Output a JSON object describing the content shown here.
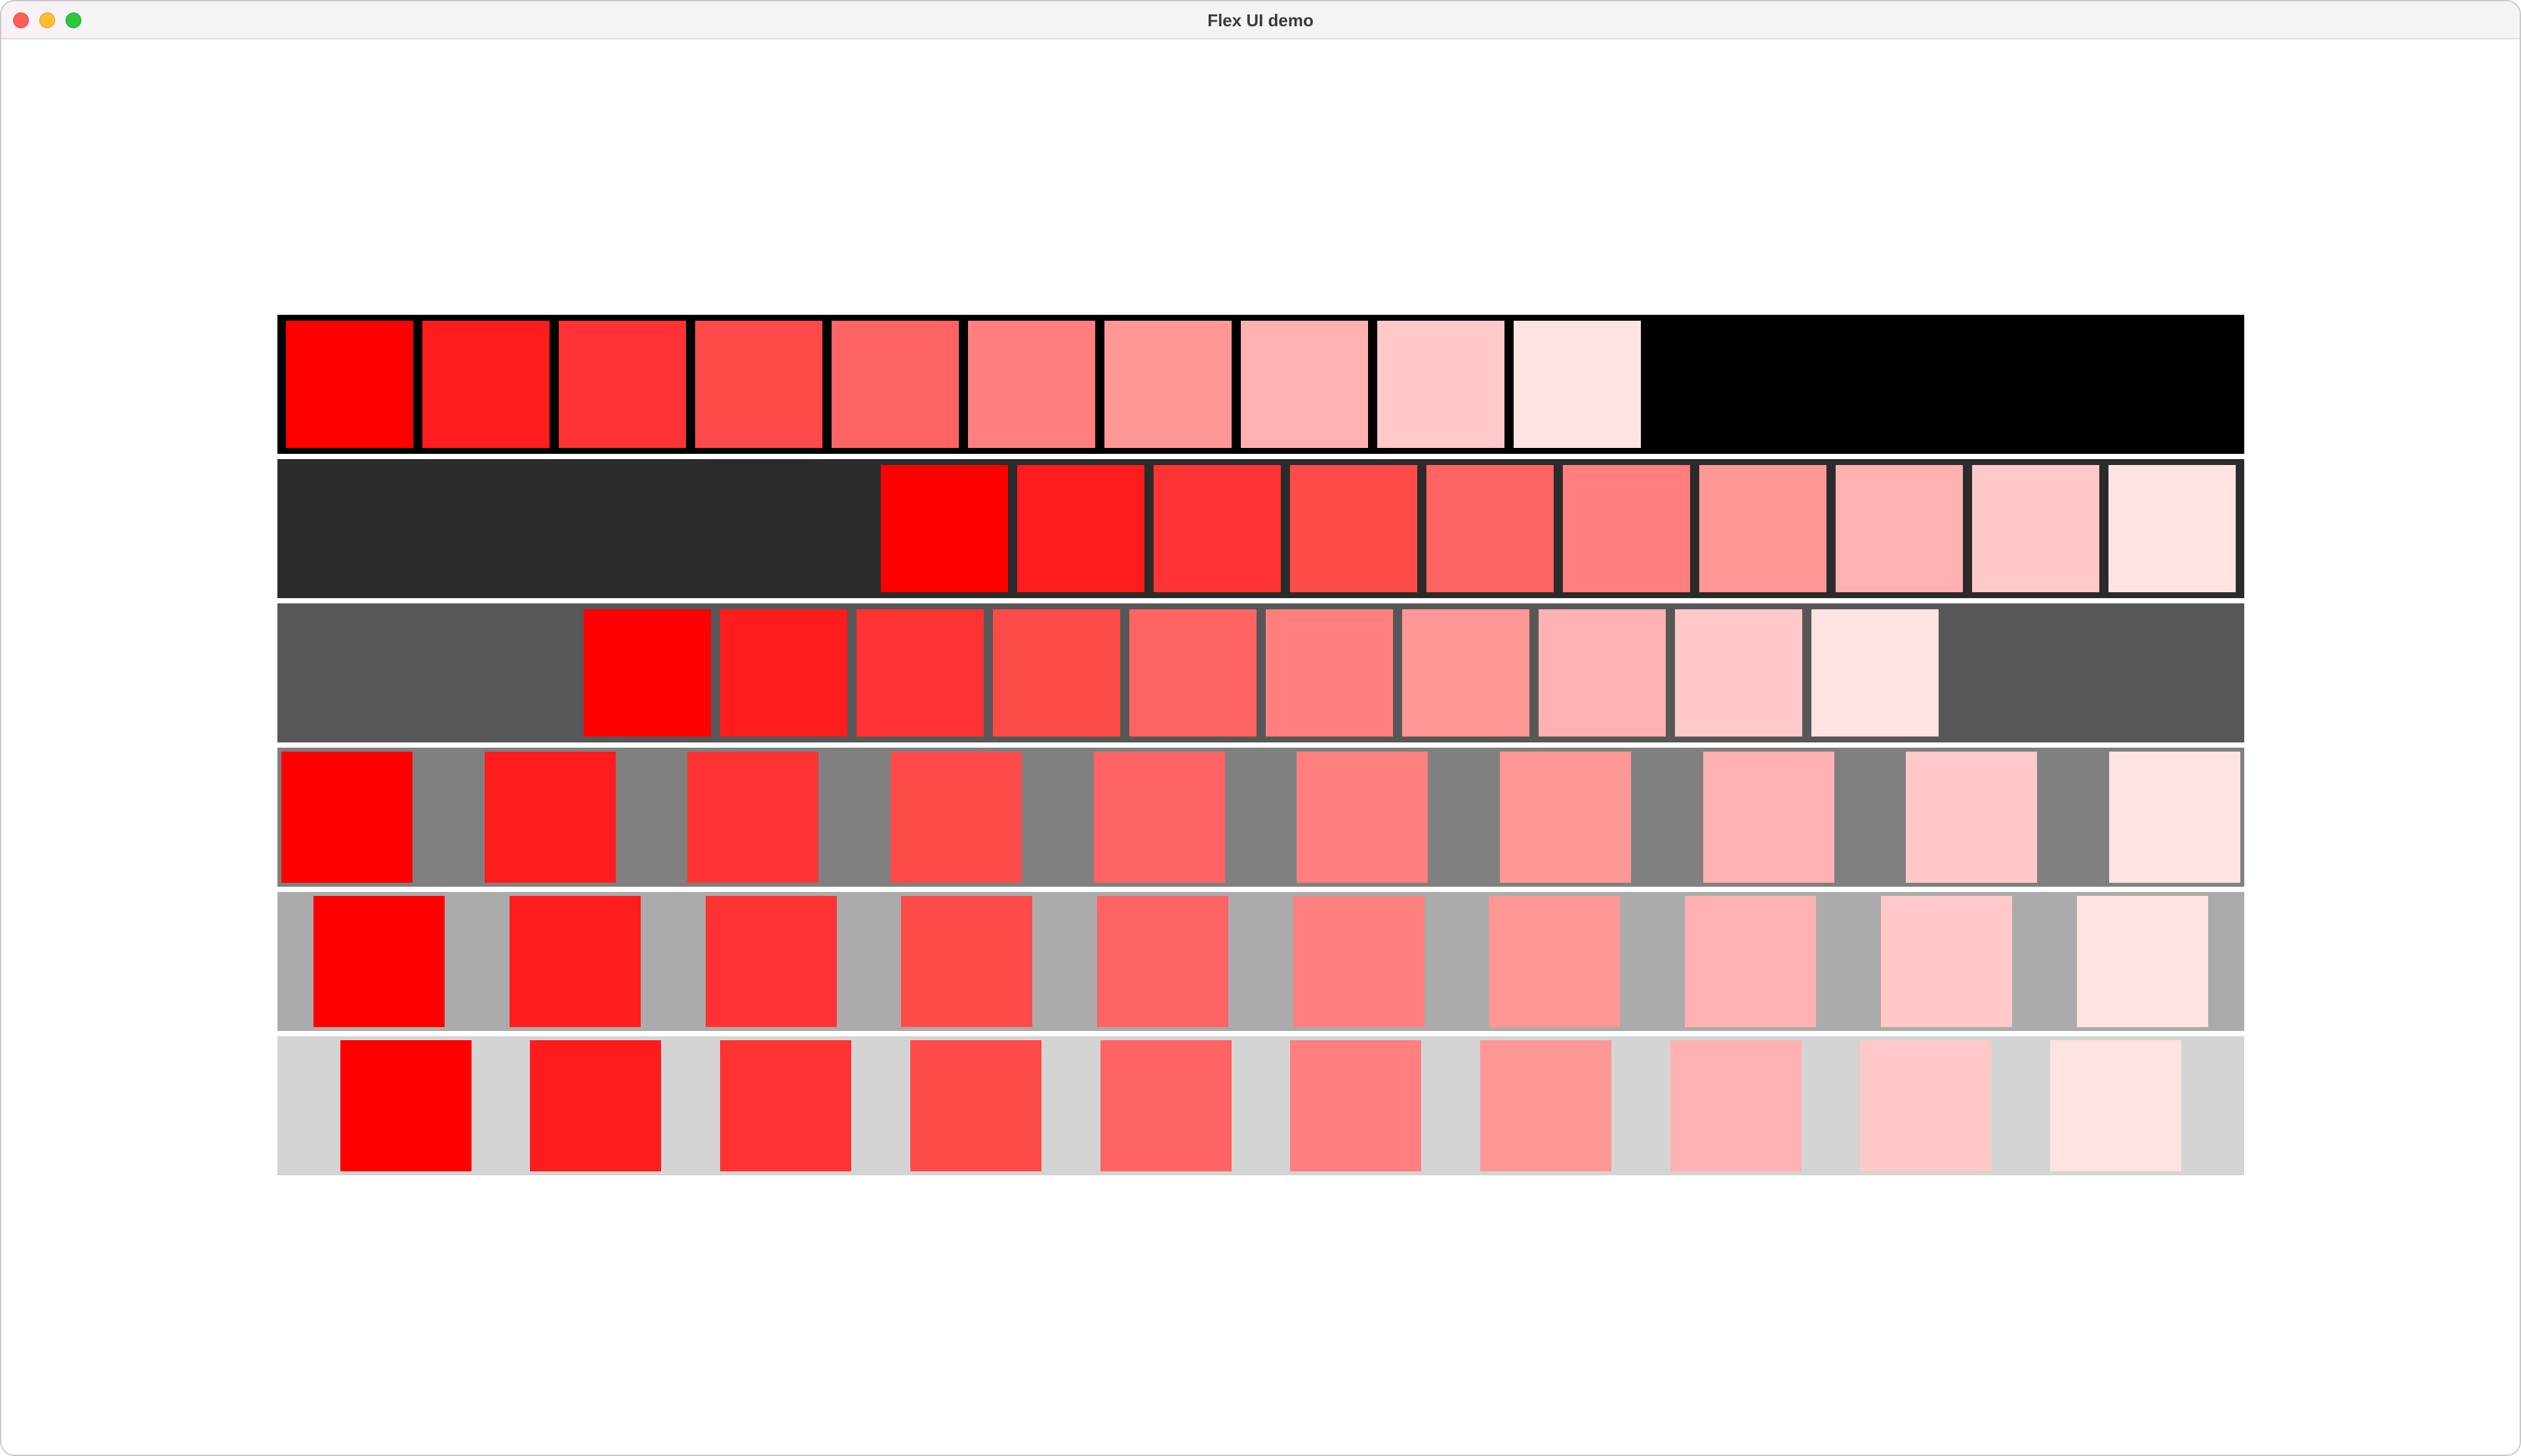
{
  "window": {
    "title": "Flex UI demo"
  },
  "box_colors": [
    "#ff0000",
    "#ff1c1c",
    "#ff3333",
    "#ff4a4a",
    "#ff6464",
    "#ff7f7f",
    "#ff9797",
    "#ffb1b1",
    "#ffc9c9",
    "#ffe3e3"
  ],
  "rows": [
    {
      "name": "row-flex-start",
      "justify": "flex-start",
      "background": "#000000",
      "box_border": "#000000"
    },
    {
      "name": "row-flex-end",
      "justify": "flex-end",
      "background": "#2b2b2b",
      "box_border": "#2b2b2b"
    },
    {
      "name": "row-center",
      "justify": "center",
      "background": "#575757",
      "box_border": "#575757"
    },
    {
      "name": "row-space-between",
      "justify": "space-between",
      "background": "#808080",
      "box_border": "#808080"
    },
    {
      "name": "row-space-around",
      "justify": "space-around",
      "background": "#ababab",
      "box_border": "#ababab"
    },
    {
      "name": "row-space-evenly",
      "justify": "space-evenly",
      "background": "#d4d4d4",
      "box_border": "#d4d4d4"
    }
  ]
}
